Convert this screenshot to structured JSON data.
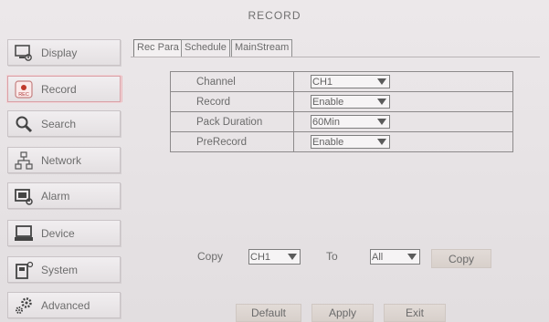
{
  "window": {
    "title": "RECORD"
  },
  "sidebar": {
    "items": [
      {
        "label": "Display",
        "icon": "monitor-icon"
      },
      {
        "label": "Record",
        "icon": "rec-icon"
      },
      {
        "label": "Search",
        "icon": "search-icon"
      },
      {
        "label": "Network",
        "icon": "network-icon"
      },
      {
        "label": "Alarm",
        "icon": "alarm-icon"
      },
      {
        "label": "Device",
        "icon": "device-icon"
      },
      {
        "label": "System",
        "icon": "system-icon"
      },
      {
        "label": "Advanced",
        "icon": "gears-icon"
      }
    ],
    "active": "Record"
  },
  "tabs": [
    {
      "label": "Rec Para"
    },
    {
      "label": "Schedule"
    },
    {
      "label": "MainStream"
    }
  ],
  "params": [
    {
      "label": "Channel",
      "value": "CH1"
    },
    {
      "label": "Record",
      "value": "Enable"
    },
    {
      "label": "Pack Duration",
      "value": "60Min"
    },
    {
      "label": "PreRecord",
      "value": "Enable"
    }
  ],
  "copy": {
    "label": "Copy",
    "from_value": "CH1",
    "to_label": "To",
    "to_value": "All",
    "button": "Copy"
  },
  "footer": {
    "default": "Default",
    "apply": "Apply",
    "exit": "Exit"
  },
  "colors": {
    "active_border": "#d9a0a6",
    "rec_red": "#c0392b"
  }
}
